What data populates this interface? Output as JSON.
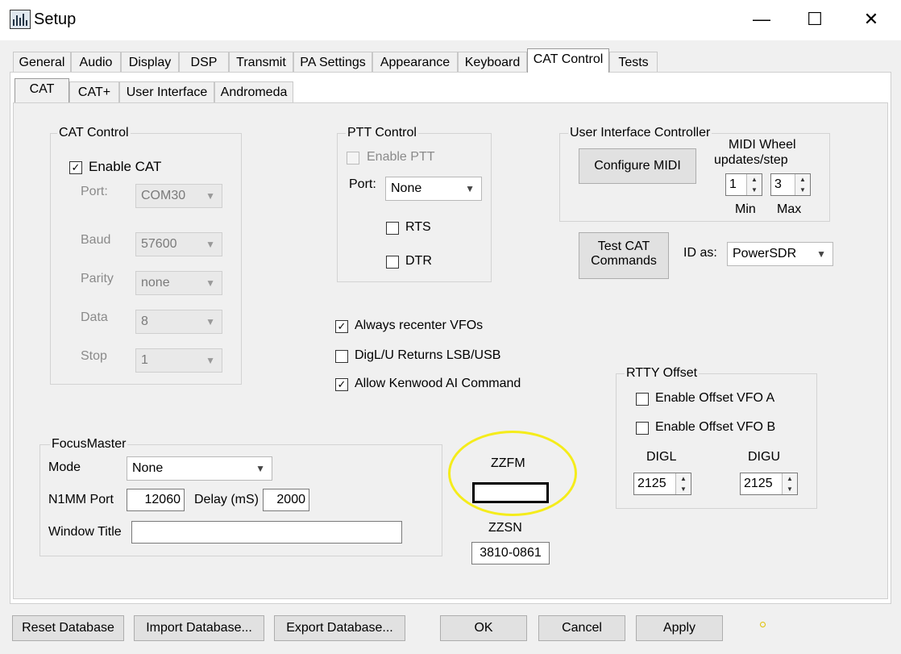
{
  "window": {
    "title": "Setup",
    "minimize": "—",
    "maximize": "☐",
    "close": "✕"
  },
  "tabs": [
    "General",
    "Audio",
    "Display",
    "DSP",
    "Transmit",
    "PA Settings",
    "Appearance",
    "Keyboard",
    "CAT Control",
    "Tests"
  ],
  "subtabs": [
    "CAT",
    "CAT+",
    "User Interface",
    "Andromeda"
  ],
  "cat_control": {
    "title": "CAT Control",
    "enable_label": "Enable CAT",
    "port_label": "Port:",
    "port_value": "COM30",
    "baud_label": "Baud",
    "baud_value": "57600",
    "parity_label": "Parity",
    "parity_value": "none",
    "data_label": "Data",
    "data_value": "8",
    "stop_label": "Stop",
    "stop_value": "1"
  },
  "ptt_control": {
    "title": "PTT Control",
    "enable_label": "Enable PTT",
    "port_label": "Port:",
    "port_value": "None",
    "rts_label": "RTS",
    "dtr_label": "DTR"
  },
  "ui_controller": {
    "title": "User Interface Controller",
    "configure_midi": "Configure MIDI",
    "wheel_line1": "MIDI  Wheel",
    "wheel_line2": "updates/step",
    "min_value": "1",
    "max_value": "3",
    "min_label": "Min",
    "max_label": "Max"
  },
  "test_cat": {
    "line1": "Test CAT",
    "line2": "Commands"
  },
  "id_as": {
    "label": "ID as:",
    "value": "PowerSDR"
  },
  "options": {
    "recenter": "Always recenter VFOs",
    "digl": "DigL/U Returns LSB/USB",
    "kenwood": "Allow Kenwood AI Command"
  },
  "rtty": {
    "title": "RTTY Offset",
    "offset_a": "Enable Offset VFO A",
    "offset_b": "Enable Offset VFO B",
    "digl_label": "DIGL",
    "digu_label": "DIGU",
    "digl_value": "2125",
    "digu_value": "2125"
  },
  "focusmaster": {
    "title": "FocusMaster",
    "mode_label": "Mode",
    "mode_value": "None",
    "n1mm_label": "N1MM Port",
    "n1mm_value": "12060",
    "delay_label": "Delay (mS)",
    "delay_value": "2000",
    "window_title_label": "Window Title",
    "window_title_value": ""
  },
  "zzfm": {
    "label": "ZZFM",
    "value": ""
  },
  "zzsn": {
    "label": "ZZSN",
    "value": "3810-0861"
  },
  "bottom": {
    "reset": "Reset Database",
    "import": "Import Database...",
    "export": "Export Database...",
    "ok": "OK",
    "cancel": "Cancel",
    "apply": "Apply"
  },
  "colors": {
    "highlight_ellipse": "#f5ec1b"
  }
}
